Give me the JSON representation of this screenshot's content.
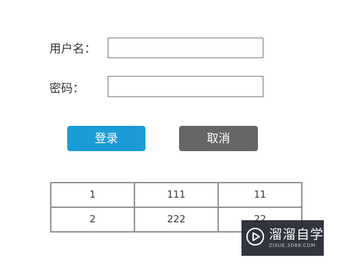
{
  "form": {
    "username_label": "用户名：",
    "username_value": "",
    "password_label": "密码：",
    "password_value": ""
  },
  "buttons": {
    "login_label": "登录",
    "login_color": "#1a9bd7",
    "cancel_label": "取消",
    "cancel_color": "#666666"
  },
  "table": {
    "rows": [
      [
        "1",
        "111",
        "11"
      ],
      [
        "2",
        "222",
        "22"
      ]
    ]
  },
  "watermark": {
    "title": "溜溜自学",
    "url": "ZIXUE.3D66.COM",
    "icon": "play-circle-icon"
  }
}
